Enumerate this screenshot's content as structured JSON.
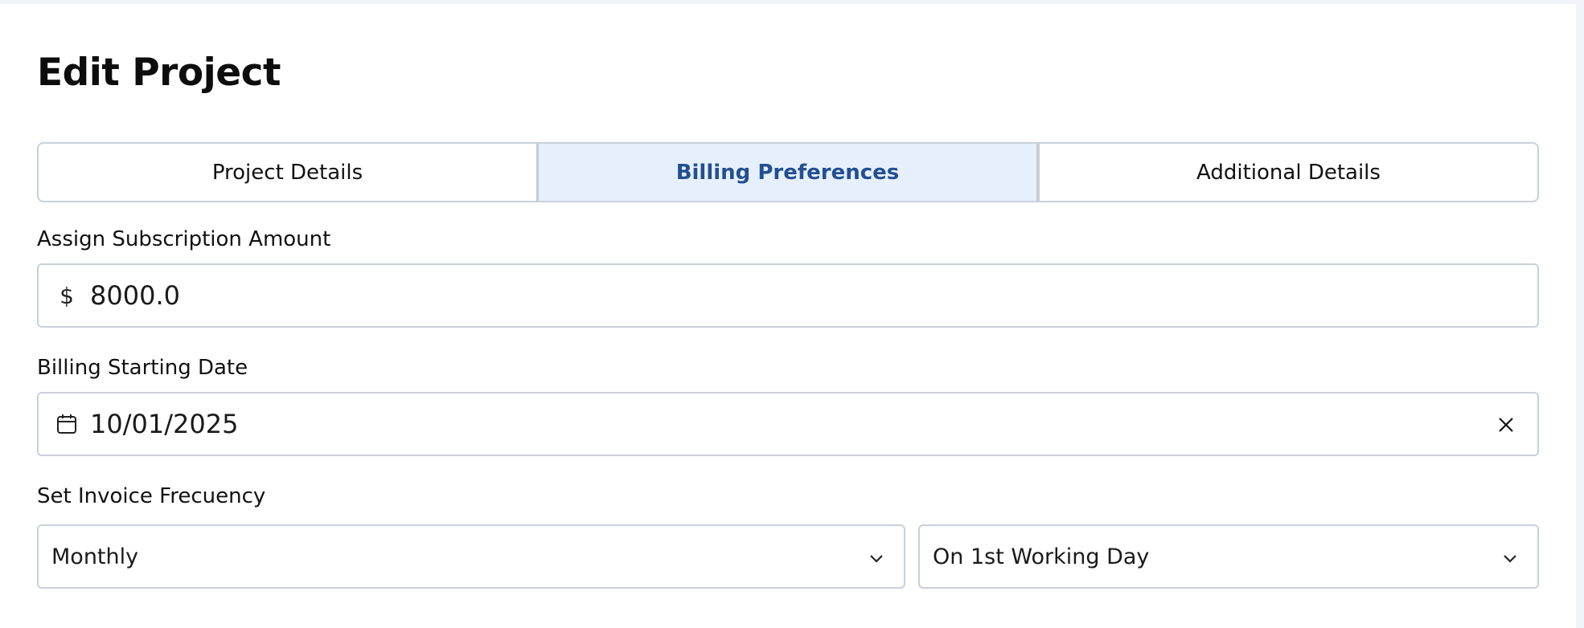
{
  "page": {
    "title": "Edit Project"
  },
  "tabs": [
    {
      "label": "Project Details",
      "active": false
    },
    {
      "label": "Billing Preferences",
      "active": true
    },
    {
      "label": "Additional Details",
      "active": false
    }
  ],
  "subscription": {
    "label": "Assign Subscription Amount",
    "prefix": "$",
    "value": "8000.0"
  },
  "billing_start": {
    "label": "Billing Starting Date",
    "value": "10/01/2025",
    "icon": "calendar-icon",
    "clear_icon": "close-icon"
  },
  "invoice_frequency": {
    "label": "Set Invoice Frecuency",
    "period": "Monthly",
    "timing": "On 1st Working Day"
  },
  "colors": {
    "accent_text": "#234f91",
    "active_tab_bg": "#e6f0fc",
    "border": "#c8d0da",
    "page_bg": "#f3f4f9"
  }
}
